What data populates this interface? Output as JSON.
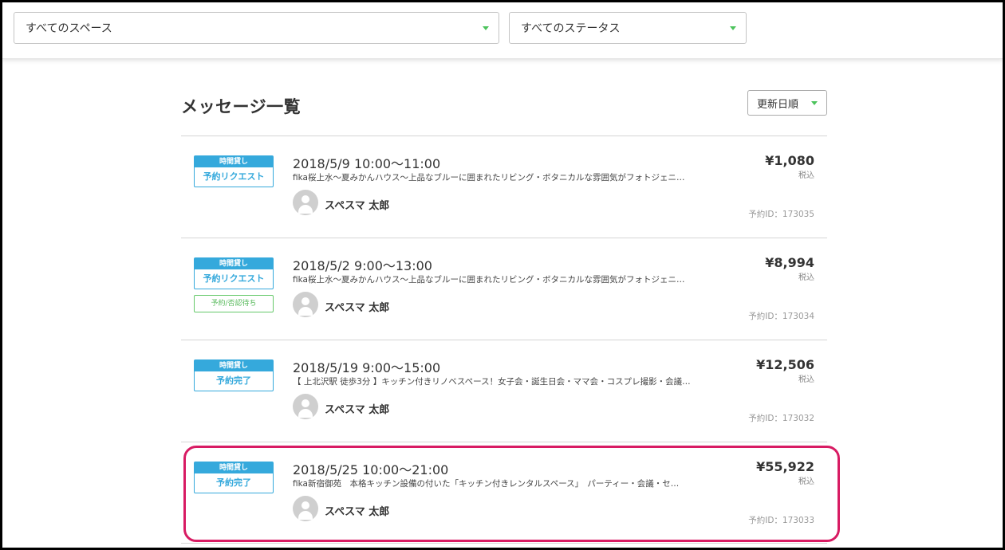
{
  "filters": {
    "space": "すべてのスペース",
    "status": "すべてのステータス"
  },
  "page": {
    "title": "メッセージ一覧",
    "sort": "更新日順"
  },
  "messages": [
    {
      "type_label": "時間貸し",
      "status_label": "予約リクエスト",
      "sub_status": "",
      "datetime": "2018/5/9 10:00〜11:00",
      "description": "fika桜上水〜夏みかんハウス〜上品なブルーに囲まれたリビング・ボタニカルな雰囲気がフォトジェニ…",
      "user": "スペスマ 太郎",
      "price": "¥1,080",
      "tax": "税込",
      "reservation_id": "予約ID：173035"
    },
    {
      "type_label": "時間貸し",
      "status_label": "予約リクエスト",
      "sub_status": "予約/否認待ち",
      "datetime": "2018/5/2 9:00〜13:00",
      "description": "fika桜上水〜夏みかんハウス〜上品なブルーに囲まれたリビング・ボタニカルな雰囲気がフォトジェニ…",
      "user": "スペスマ 太郎",
      "price": "¥8,994",
      "tax": "税込",
      "reservation_id": "予約ID：173034"
    },
    {
      "type_label": "時間貸し",
      "status_label": "予約完了",
      "sub_status": "",
      "datetime": "2018/5/19 9:00〜15:00",
      "description": "【 上北沢駅 徒歩3分 】キッチン付きリノベスペース！女子会・誕生日会・ママ会・コスプレ撮影・会議…",
      "user": "スペスマ 太郎",
      "price": "¥12,506",
      "tax": "税込",
      "reservation_id": "予約ID：173032"
    },
    {
      "type_label": "時間貸し",
      "status_label": "予約完了",
      "sub_status": "",
      "datetime": "2018/5/25 10:00〜21:00",
      "description": "fika新宿御苑　本格キッチン設備の付いた「キッチン付きレンタルスペース」　パーティー・会議・セ…",
      "user": "スペスマ 太郎",
      "price": "¥55,922",
      "tax": "税込",
      "reservation_id": "予約ID：173033"
    }
  ],
  "colors": {
    "accent_blue": "#35a9dc",
    "accent_green": "#4cc35c",
    "highlight": "#d81b63"
  }
}
